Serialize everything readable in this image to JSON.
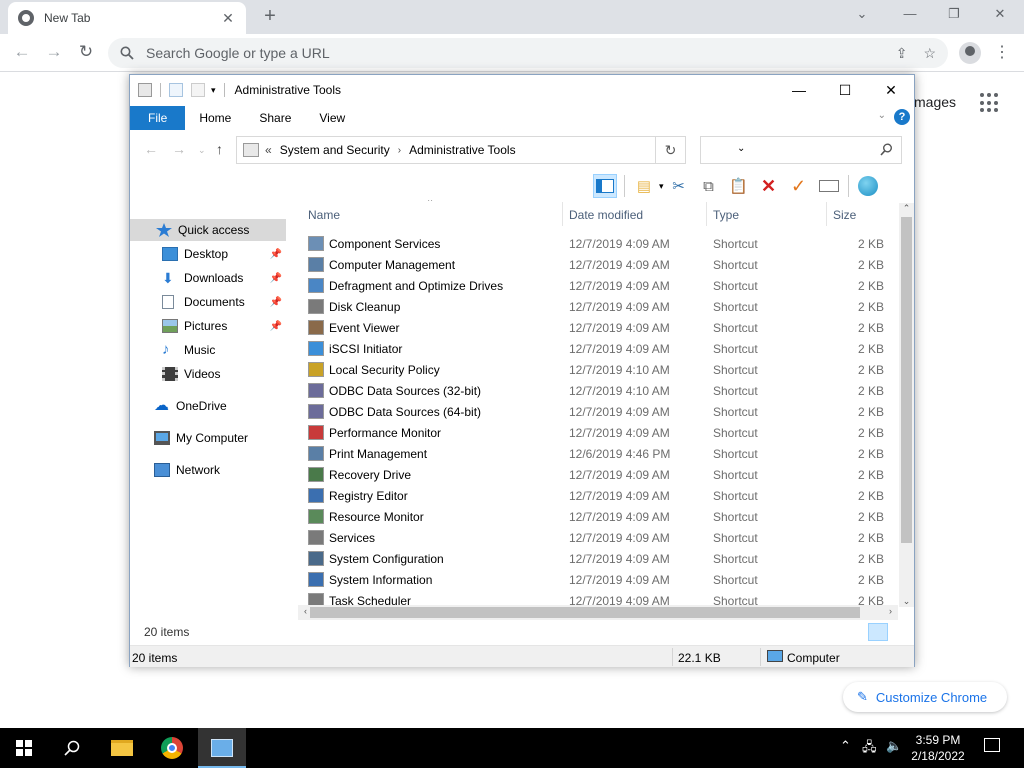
{
  "browser": {
    "tab_title": "New Tab",
    "tab_close": "✕",
    "new_tab": "+",
    "omnibox_placeholder": "Search Google or type a URL",
    "images_link": "mages",
    "customize_label": "Customize Chrome"
  },
  "explorer": {
    "title": "Administrative Tools",
    "ribbon_tabs": [
      "File",
      "Home",
      "Share",
      "View"
    ],
    "breadcrumb": [
      "System and Security",
      "Administrative Tools"
    ],
    "breadcrumb_prefix": "«",
    "columns": [
      "Name",
      "Date modified",
      "Type",
      "Size"
    ],
    "nav": {
      "quick_access": "Quick access",
      "desktop": "Desktop",
      "downloads": "Downloads",
      "documents": "Documents",
      "pictures": "Pictures",
      "music": "Music",
      "videos": "Videos",
      "onedrive": "OneDrive",
      "mycomputer": "My Computer",
      "network": "Network"
    },
    "files": [
      {
        "name": "Component Services",
        "date": "12/7/2019 4:09 AM",
        "type": "Shortcut",
        "size": "2 KB"
      },
      {
        "name": "Computer Management",
        "date": "12/7/2019 4:09 AM",
        "type": "Shortcut",
        "size": "2 KB"
      },
      {
        "name": "Defragment and Optimize Drives",
        "date": "12/7/2019 4:09 AM",
        "type": "Shortcut",
        "size": "2 KB"
      },
      {
        "name": "Disk Cleanup",
        "date": "12/7/2019 4:09 AM",
        "type": "Shortcut",
        "size": "2 KB"
      },
      {
        "name": "Event Viewer",
        "date": "12/7/2019 4:09 AM",
        "type": "Shortcut",
        "size": "2 KB"
      },
      {
        "name": "iSCSI Initiator",
        "date": "12/7/2019 4:09 AM",
        "type": "Shortcut",
        "size": "2 KB"
      },
      {
        "name": "Local Security Policy",
        "date": "12/7/2019 4:10 AM",
        "type": "Shortcut",
        "size": "2 KB"
      },
      {
        "name": "ODBC Data Sources (32-bit)",
        "date": "12/7/2019 4:10 AM",
        "type": "Shortcut",
        "size": "2 KB"
      },
      {
        "name": "ODBC Data Sources (64-bit)",
        "date": "12/7/2019 4:09 AM",
        "type": "Shortcut",
        "size": "2 KB"
      },
      {
        "name": "Performance Monitor",
        "date": "12/7/2019 4:09 AM",
        "type": "Shortcut",
        "size": "2 KB"
      },
      {
        "name": "Print Management",
        "date": "12/6/2019 4:46 PM",
        "type": "Shortcut",
        "size": "2 KB"
      },
      {
        "name": "Recovery Drive",
        "date": "12/7/2019 4:09 AM",
        "type": "Shortcut",
        "size": "2 KB"
      },
      {
        "name": "Registry Editor",
        "date": "12/7/2019 4:09 AM",
        "type": "Shortcut",
        "size": "2 KB"
      },
      {
        "name": "Resource Monitor",
        "date": "12/7/2019 4:09 AM",
        "type": "Shortcut",
        "size": "2 KB"
      },
      {
        "name": "Services",
        "date": "12/7/2019 4:09 AM",
        "type": "Shortcut",
        "size": "2 KB"
      },
      {
        "name": "System Configuration",
        "date": "12/7/2019 4:09 AM",
        "type": "Shortcut",
        "size": "2 KB"
      },
      {
        "name": "System Information",
        "date": "12/7/2019 4:09 AM",
        "type": "Shortcut",
        "size": "2 KB"
      },
      {
        "name": "Task Scheduler",
        "date": "12/7/2019 4:09 AM",
        "type": "Shortcut",
        "size": "2 KB"
      }
    ],
    "inner_status": "20 items",
    "status": {
      "items": "20 items",
      "size": "22.1 KB",
      "location": "Computer"
    }
  },
  "taskbar": {
    "time": "3:59 PM",
    "date": "2/18/2022"
  },
  "colors": {
    "accent": "#1979ca",
    "selection": "#cce8ff",
    "chrome_link": "#1a73e8"
  }
}
